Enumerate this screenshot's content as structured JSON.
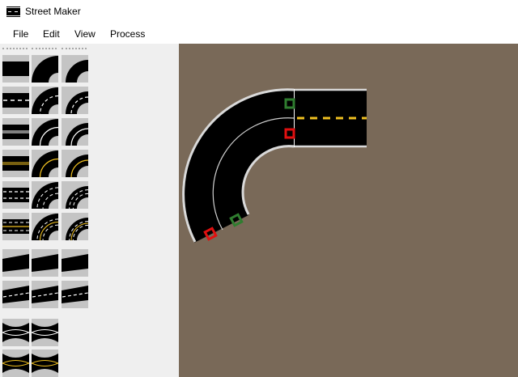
{
  "window": {
    "title": "Street Maker",
    "app_icon": "road-icon"
  },
  "menu": [
    {
      "label": "File"
    },
    {
      "label": "Edit"
    },
    {
      "label": "View"
    },
    {
      "label": "Process"
    }
  ],
  "palette": {
    "columns": [
      {
        "name": "straight",
        "tiles": [
          "plain",
          "dashed-white",
          "double-white",
          "double-yellow",
          "multi-lane",
          "multi-lane-yellow",
          "lane-shift",
          "lane-shift-dashed",
          "taper",
          "taper-yellow"
        ]
      },
      {
        "name": "curve",
        "tiles": [
          "plain",
          "dashed-white",
          "white-center",
          "yellow-center",
          "multi-lane",
          "multi-lane-yellow",
          "lane-shift",
          "lane-shift-dashed",
          "taper",
          "taper-yellow"
        ]
      },
      {
        "name": "curve-small",
        "tiles": [
          "plain",
          "dashed-white",
          "white-center",
          "yellow-center",
          "multi-lane",
          "multi-lane-yellow",
          "shift",
          "shift-dashed"
        ]
      }
    ]
  },
  "colors": {
    "canvas": "#796958",
    "road": "#000000",
    "curb": "#d9d9d9",
    "yellow_line": "#f0c020",
    "connector_start": "#2f7d2f",
    "connector_end": "#e01010"
  }
}
